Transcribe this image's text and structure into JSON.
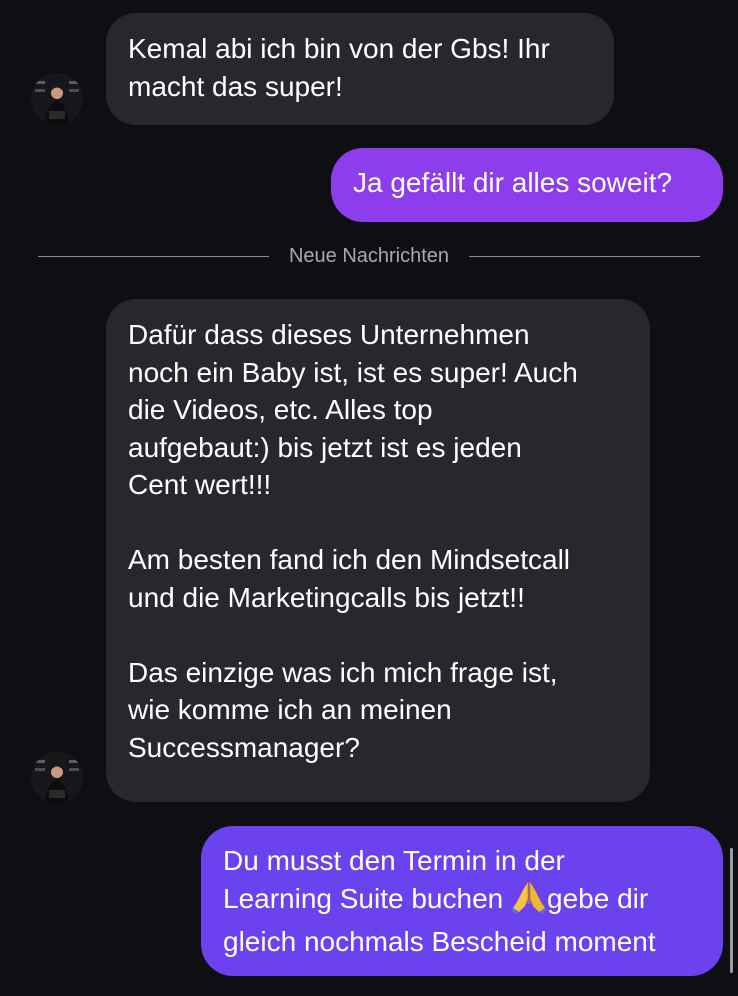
{
  "messages": [
    {
      "direction": "incoming",
      "text": "Kemal abi ich bin von der Gbs! Ihr\nmacht das super!"
    },
    {
      "direction": "outgoing",
      "text": "Ja gefällt dir alles soweit?"
    },
    {
      "direction": "incoming",
      "text": "Dafür dass dieses Unternehmen\nnoch ein Baby ist, ist es super! Auch\ndie Videos, etc. Alles top\naufgebaut:) bis jetzt ist es jeden\nCent wert!!!\n\nAm besten fand ich den Mindsetcall\nund die Marketingcalls bis jetzt!!\n\nDas einzige was ich mich frage ist,\nwie komme ich an meinen\nSuccessmanager?"
    },
    {
      "direction": "outgoing",
      "text_before_emoji": "Du musst den Termin in der\nLearning Suite buchen ",
      "emoji": "praying-hands-icon",
      "text_after_emoji": "gebe dir\ngleich nochmals Bescheid moment"
    }
  ],
  "divider": {
    "label": "Neue Nachrichten"
  },
  "colors": {
    "background": "#0d0f13",
    "incoming_bubble": "#26282e",
    "outgoing_bubble_1": "#8e3dec",
    "outgoing_bubble_2": "#6b42ee",
    "text": "#ffffff",
    "divider_text": "#a8aab0"
  }
}
